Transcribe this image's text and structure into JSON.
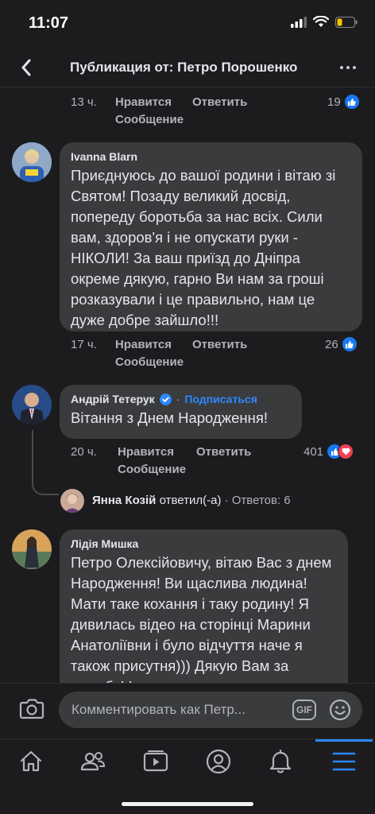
{
  "status_bar": {
    "time": "11:07"
  },
  "header": {
    "title": "Публикация от: Петро Порошенко"
  },
  "first_comment_footer": {
    "time": "13 ч.",
    "like_label": "Нравится",
    "reply_label": "Ответить",
    "message_label": "Сообщение",
    "reaction_count": "19"
  },
  "comments": [
    {
      "author": "Ivanna  Blarn",
      "text": "Приєднуюсь до вашої родини і вітаю зі Святом! Позаду великий досвід, попереду боротьба за нас всіх. Сили вам, здоров'я і не опускати руки - НІКОЛИ! За ваш приїзд до Дніпра окреме дякую, гарно Ви нам за гроші розказували і це правильно, нам це дуже добре зайшло!!!",
      "time": "17 ч.",
      "like_label": "Нравится",
      "reply_label": "Ответить",
      "message_label": "Сообщение",
      "reaction_count": "26"
    },
    {
      "author": "Андрій Тетерук",
      "verified": true,
      "separator": "·",
      "subscribe_label": "Подписаться",
      "text": "Вітання з Днем Народження!",
      "time": "20 ч.",
      "like_label": "Нравится",
      "reply_label": "Ответить",
      "message_label": "Сообщение",
      "reaction_count": "401"
    },
    {
      "author": "Лідія Мишка",
      "text": "Петро Олексійовичу, вітаю Вас з днем Народження! Ви щаслива людина! Мати таке кохання і таку родину! Я дивилась відео на сторінці Марини Анатоліївни і було відчуття наче я також присутня))) Дякую Вам за дружбу! І як другу"
    }
  ],
  "reply_summary": {
    "name": "Янна Козій",
    "action": "ответил(-а)",
    "replies": "· Ответов: 6"
  },
  "composer": {
    "placeholder": "Комментировать как Петр...",
    "gif_label": "GIF"
  },
  "tabs": [
    {
      "icon": "home-icon"
    },
    {
      "icon": "friends-icon"
    },
    {
      "icon": "watch-icon"
    },
    {
      "icon": "profile-icon"
    },
    {
      "icon": "bell-icon"
    },
    {
      "icon": "menu-icon",
      "active": true
    }
  ],
  "colors": {
    "background": "#1c1c1e",
    "bubble": "#3a3b3c",
    "accent": "#2d88ff",
    "muted_text": "#b0b3b8",
    "heart": "#f33e58"
  }
}
